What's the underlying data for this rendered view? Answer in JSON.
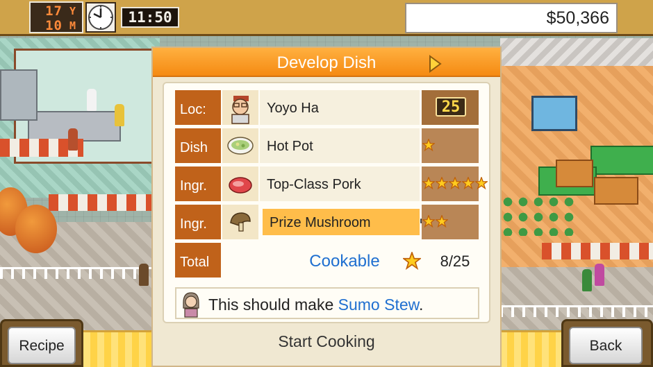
{
  "status_bar": {
    "year_value": "17",
    "year_unit": "Y",
    "month_value": "10",
    "month_unit": "M",
    "clock_icon": "clock-icon",
    "time": "11:50",
    "money": "$50,366"
  },
  "dialog": {
    "title": "Develop Dish",
    "next_icon": "next-arrow-icon",
    "rows": [
      {
        "label": "Loc:",
        "icon": "staff-portrait-icon",
        "value": "Yoyo Ha",
        "level": "25"
      },
      {
        "label": "Dish",
        "icon": "hot-pot-icon",
        "value": "Hot Pot",
        "stars": 1
      },
      {
        "label": "Ingr.",
        "icon": "pork-icon",
        "value": "Top-Class Pork",
        "stars": 5
      },
      {
        "label": "Ingr.",
        "icon": "mushroom-icon",
        "value": "Prize Mushroom",
        "stars": 2,
        "selected": true
      }
    ],
    "total": {
      "label": "Total",
      "status": "Cookable",
      "score": "8/25"
    },
    "message": {
      "prefix": "This should make ",
      "dish": "Sumo Stew",
      "suffix": "."
    },
    "start_button": "Start Cooking"
  },
  "buttons": {
    "recipe": "Recipe",
    "back": "Back"
  },
  "colors": {
    "header_orange": "#f58a12",
    "label_brown": "#c0621a",
    "link_blue": "#1f6fd0",
    "star_yellow": "#ffcc1f"
  }
}
